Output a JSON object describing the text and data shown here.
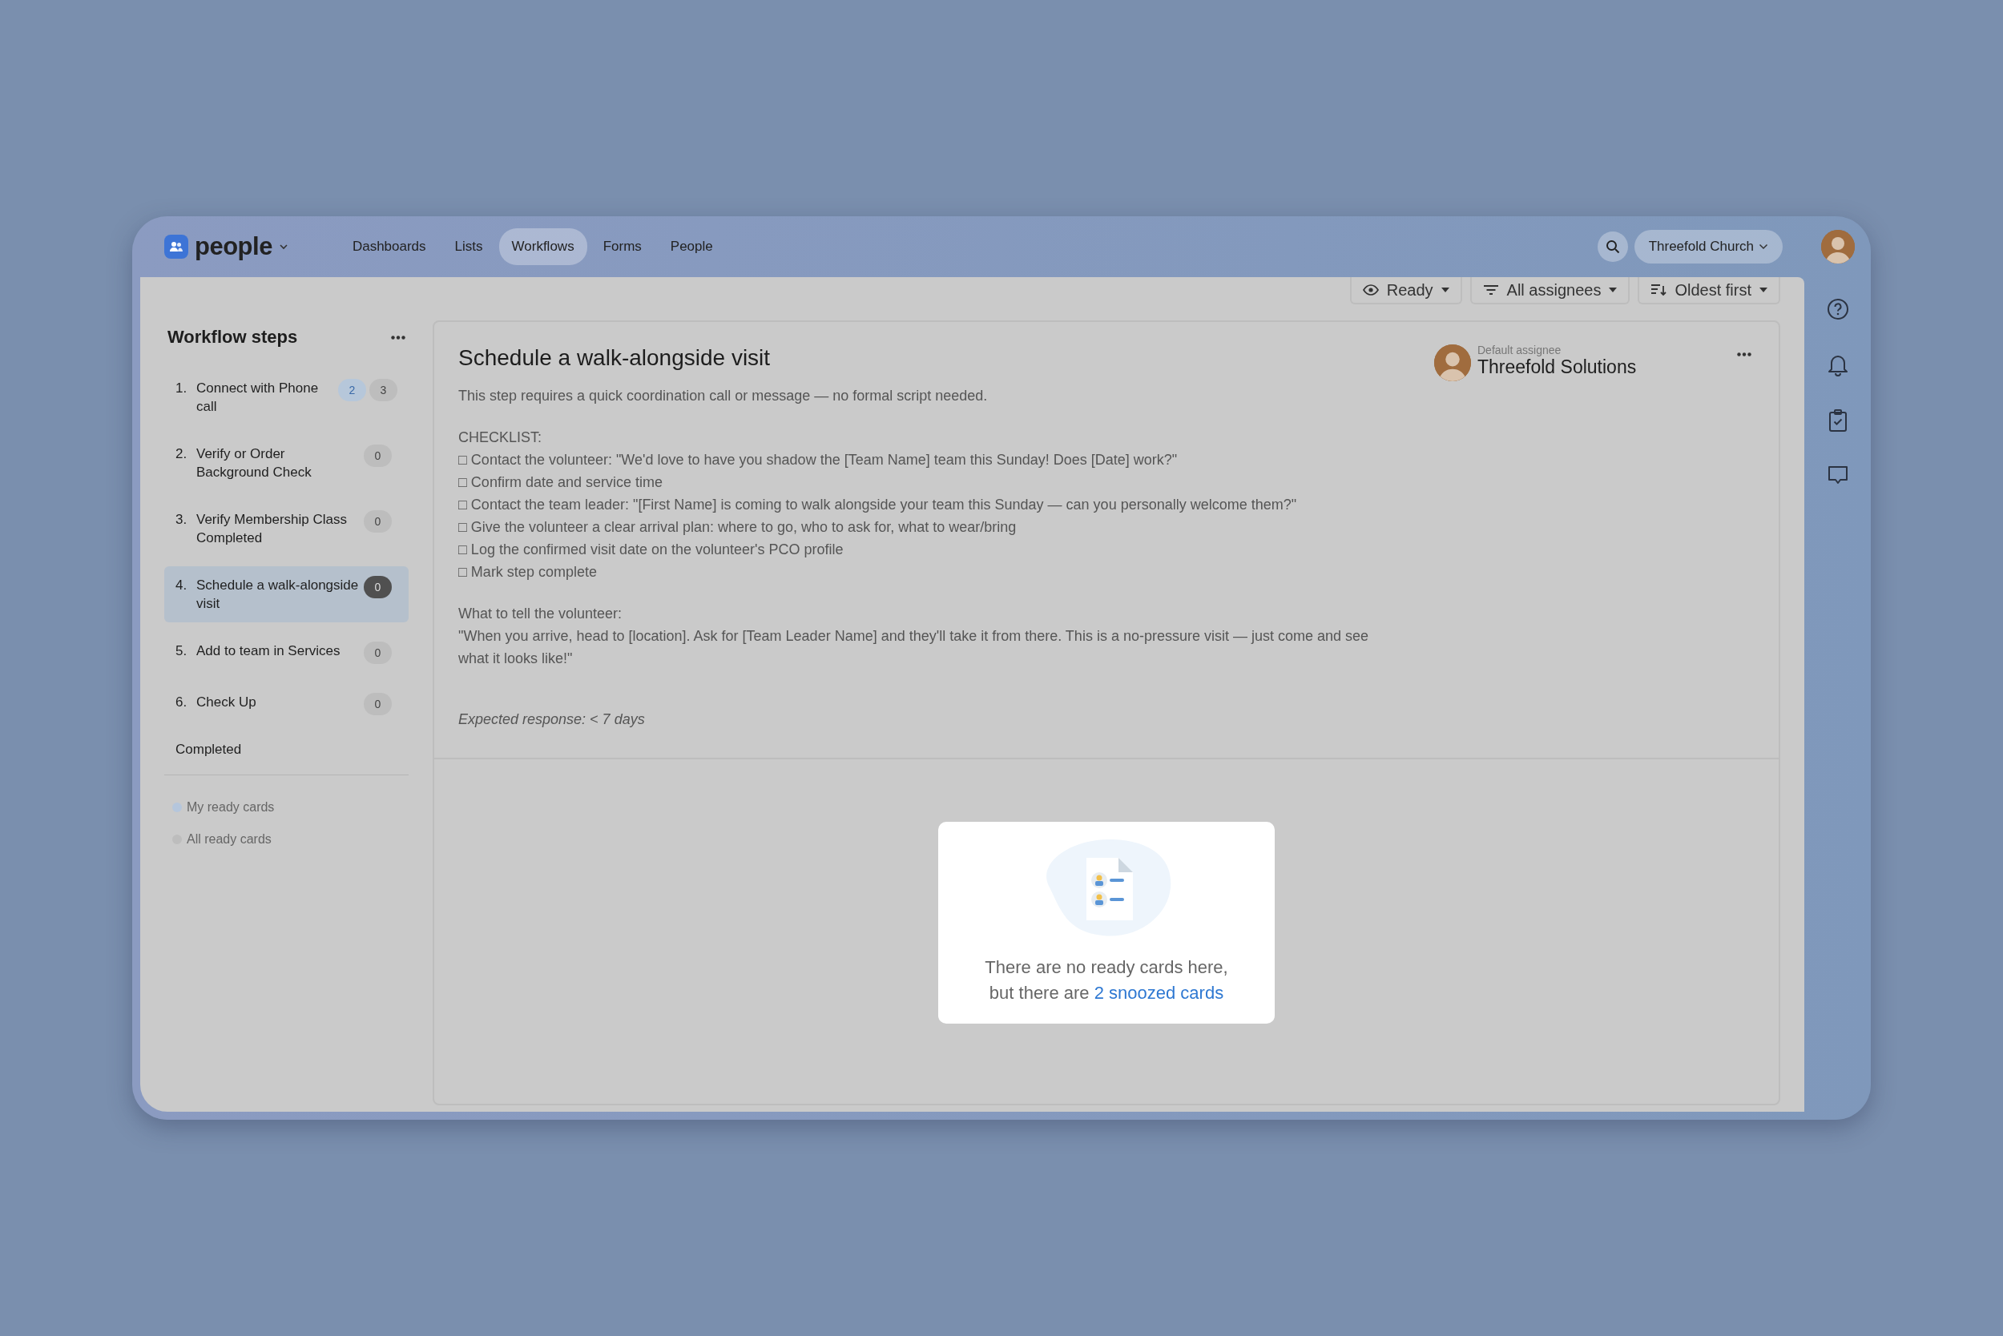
{
  "app": {
    "logo": "people",
    "nav": [
      {
        "label": "Dashboards",
        "selected": false
      },
      {
        "label": "Lists",
        "selected": false
      },
      {
        "label": "Workflows",
        "selected": true
      },
      {
        "label": "Forms",
        "selected": false
      },
      {
        "label": "People",
        "selected": false
      }
    ],
    "organization": "Threefold Church"
  },
  "filters": [
    {
      "kind": "eye",
      "label": "Ready"
    },
    {
      "kind": "filter",
      "label": "All assignees"
    },
    {
      "kind": "sort",
      "label": "Oldest first"
    }
  ],
  "sidebar": {
    "title": "Workflow steps",
    "steps": [
      {
        "number": "1.",
        "label": "Connect with Phone call",
        "selected": false,
        "counts": [
          {
            "kind": "mine",
            "value": "2"
          },
          {
            "kind": "total",
            "value": "3"
          }
        ]
      },
      {
        "number": "2.",
        "label": "Verify or Order Background Check",
        "selected": false,
        "counts": [
          {
            "kind": "total",
            "value": "0"
          }
        ]
      },
      {
        "number": "3.",
        "label": "Verify Membership Class Completed",
        "selected": false,
        "counts": [
          {
            "kind": "total",
            "value": "0"
          }
        ]
      },
      {
        "number": "4.",
        "label": "Schedule a walk-alongside visit",
        "selected": true,
        "counts": [
          {
            "kind": "total",
            "value": "0"
          }
        ]
      },
      {
        "number": "5.",
        "label": "Add to team in Services",
        "selected": false,
        "counts": [
          {
            "kind": "total",
            "value": "0"
          }
        ]
      },
      {
        "number": "6.",
        "label": "Check Up",
        "selected": false,
        "counts": [
          {
            "kind": "total",
            "value": "0"
          }
        ]
      }
    ],
    "completed": "Completed",
    "card_filters": [
      {
        "label": "My ready cards",
        "color": "#b5c6dc"
      },
      {
        "label": "All ready cards",
        "color": "#bdbdbd"
      }
    ]
  },
  "step": {
    "title": "Schedule a walk-alongside visit",
    "assignee_caption": "Default assignee",
    "assignee": "Threefold Solutions",
    "description": "This step requires a quick coordination call or message — no formal script needed.",
    "checklist_heading": "CHECKLIST:",
    "checklist": [
      "□ Contact the volunteer: \"We'd love to have you shadow the [Team Name] team this Sunday! Does [Date] work?\"",
      "□ Confirm date and service time",
      "□ Contact the team leader: \"[First Name] is coming to walk alongside your team this Sunday — can you personally welcome them?\"",
      "□ Give the volunteer a clear arrival plan: where to go, who to ask for, what to wear/bring",
      "□ Log the confirmed visit date on the volunteer's PCO profile",
      "□ Mark step complete"
    ],
    "tell_heading": "What to tell the volunteer:",
    "tell_text": "\"When you arrive, head to [location]. Ask for [Team Leader Name] and they'll take it from there. This is a no-pressure visit — just come and see what it looks like!\"",
    "expected": "Expected response: < 7 days"
  },
  "empty_state": {
    "line_1": "There are no ready cards here,",
    "line_2": "but there are",
    "link": "2 snoozed cards"
  }
}
